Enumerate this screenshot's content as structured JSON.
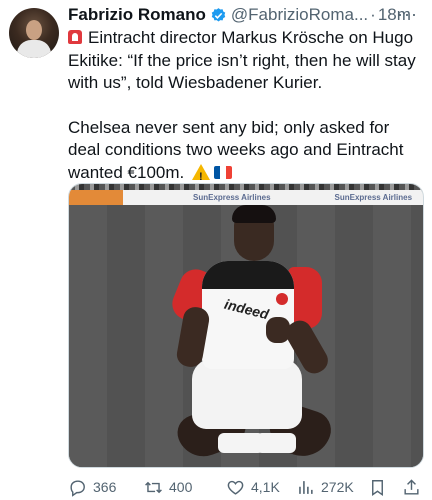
{
  "tweet": {
    "author_name": "Fabrizio Romano",
    "handle": "@FabrizioRoma...",
    "separator": "·",
    "time": "18m",
    "more_label": "···",
    "paragraph1": "Eintracht director Markus Krösche on Hugo Ekitike: “If the price isn’t right, then he will stay with us”, told Wiesbadener Kurier.",
    "paragraph2": "Chelsea never sent any bid; only asked for deal conditions two weeks ago and Eintracht wanted €100m.",
    "emoji_prefix": "siren-icon",
    "emoji_suffix": [
      "warning-icon",
      "france-flag-icon"
    ]
  },
  "media": {
    "billboard_text_1": "SunExpress Airlines",
    "billboard_text_2": "SunExpress Airlines",
    "jersey_sponsor": "indeed"
  },
  "actions": {
    "replies": "366",
    "retweets": "400",
    "likes": "4,1K",
    "views": "272K"
  },
  "colors": {
    "verified": "#1d9bf0",
    "text_secondary": "#536471",
    "text_primary": "#0f1419"
  }
}
